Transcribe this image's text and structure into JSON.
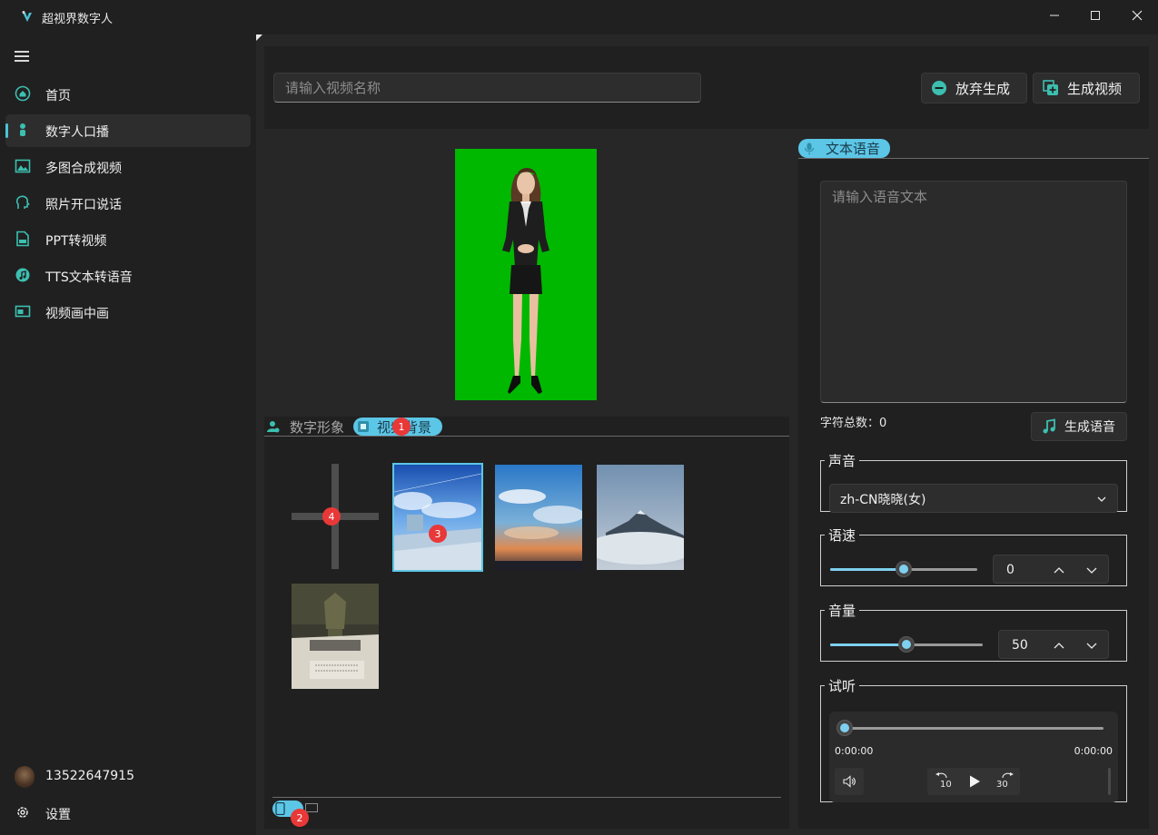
{
  "window": {
    "title": "超视界数字人"
  },
  "sidebar": {
    "items": [
      {
        "label": "首页",
        "icon": "home-icon",
        "active": false
      },
      {
        "label": "数字人口播",
        "icon": "digital-human-icon",
        "active": true
      },
      {
        "label": "多图合成视频",
        "icon": "image-gallery-icon",
        "active": false
      },
      {
        "label": "照片开口说话",
        "icon": "talking-head-icon",
        "active": false
      },
      {
        "label": "PPT转视频",
        "icon": "ppt-icon",
        "active": false
      },
      {
        "label": "TTS文本转语音",
        "icon": "music-disc-icon",
        "active": false
      },
      {
        "label": "视频画中画",
        "icon": "picture-in-picture-icon",
        "active": false
      }
    ],
    "user": "13522647915",
    "settings": "设置"
  },
  "toolbar": {
    "name_placeholder": "请输入视频名称",
    "name_value": "",
    "discard_label": "放弃生成",
    "generate_label": "生成视频"
  },
  "tabs": {
    "avatar_tab": "数字形象",
    "background_tab": "视频背景"
  },
  "badges": [
    "1",
    "2",
    "3",
    "4"
  ],
  "backgrounds": [
    {
      "name": "anime-sky-rooftop",
      "selected": true
    },
    {
      "name": "sunset-clouds",
      "selected": false
    },
    {
      "name": "misty-mountain",
      "selected": false
    },
    {
      "name": "museum-bronze",
      "selected": false
    }
  ],
  "tts": {
    "tab_label": "文本语音",
    "text_placeholder": "请输入语音文本",
    "char_count_label": "字符总数：",
    "char_count": "0",
    "generate_voice_label": "生成语音",
    "voice": {
      "legend": "声音",
      "selected": "zh-CN晓晓(女)"
    },
    "speed": {
      "legend": "语速",
      "value": "0",
      "fraction": 0.5
    },
    "volume": {
      "legend": "音量",
      "value": "50",
      "fraction": 0.5
    },
    "preview": {
      "legend": "试听",
      "current_time": "0:00:00",
      "total_time": "0:00:00",
      "rewind_seconds": "10",
      "forward_seconds": "30"
    }
  },
  "colors": {
    "accent": "#5cc6e6",
    "green_screen": "#00b800",
    "badge": "#e83838"
  }
}
